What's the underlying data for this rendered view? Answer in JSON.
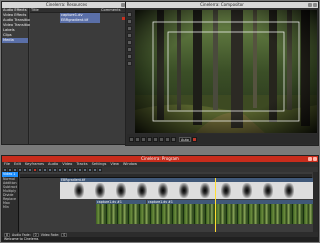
{
  "resources": {
    "title": "Cinelerra: Resources",
    "folders": [
      {
        "label": "Audio Effects",
        "selected": false
      },
      {
        "label": "Video Effects",
        "selected": false
      },
      {
        "label": "Audio Transitions",
        "selected": false
      },
      {
        "label": "Video Transitions",
        "selected": false
      },
      {
        "label": "Labels",
        "selected": false
      },
      {
        "label": "Clips",
        "selected": false
      },
      {
        "label": "Media",
        "selected": true
      }
    ],
    "columns": [
      "Title",
      "Comments"
    ],
    "rows": [
      {
        "c1": "capture1.dv",
        "c2": ""
      },
      {
        "c1": "EBRgradient.tif",
        "c2": ""
      }
    ]
  },
  "compositor": {
    "title": "Cinelerra: Compositor",
    "zoom": "Auto"
  },
  "program": {
    "title": "Cinelerra: Program",
    "menu": [
      "File",
      "Edit",
      "Keyframes",
      "Audio",
      "Video",
      "Tracks",
      "Settings",
      "View",
      "Window"
    ],
    "left_panel": {
      "header": "Video 1",
      "items": [
        "Normal",
        "Addition",
        "Subtract",
        "Multiply",
        "Divide",
        "Replace",
        "Max",
        "Min"
      ]
    },
    "clips": {
      "gradient_title": "EBRgradient.tif",
      "video_title_a": "capture1.dv #1",
      "video_title_b": "capture1.dv #1"
    },
    "zoom_bar": {
      "samples": "8",
      "audio_fade_label": "Audio Fade:",
      "audio_fade": "0",
      "video_fade_label": "Video Fade:",
      "video_fade": "0"
    },
    "status": "Welcome to Cinelerra."
  }
}
